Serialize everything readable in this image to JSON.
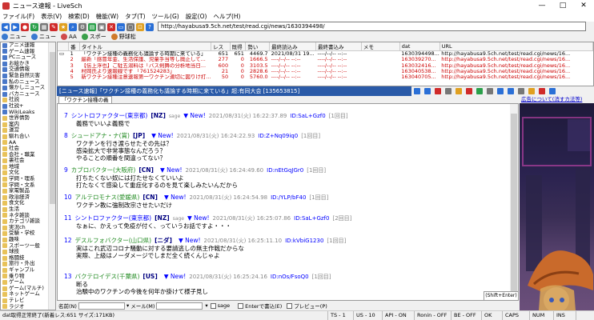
{
  "window": {
    "title": "ニュース速報 - LiveSch",
    "minimize": "—",
    "maximize": "□",
    "close": "✕"
  },
  "menu": [
    "ファイル(F)",
    "表示(V)",
    "検索(D)",
    "機能(W)",
    "タブ(T)",
    "ツール(G)",
    "設定(O)",
    "ヘルプ(H)"
  ],
  "url": "http://hayabusa9.5ch.net/test/read.cgi/news/1630394498/",
  "toolbar2": [
    {
      "label": "ニュー",
      "color": "#3a7ad0"
    },
    {
      "label": "ニュー",
      "color": "#3a7ad0"
    },
    {
      "label": "AA",
      "color": "#d04a4a"
    },
    {
      "label": "スポー",
      "color": "#3aa04a"
    },
    {
      "label": "野球松",
      "color": "#d07a2a"
    }
  ],
  "tree": [
    {
      "icon": "b",
      "label": "アニメ速報"
    },
    {
      "icon": "b",
      "label": "ゲーム速報"
    },
    {
      "icon": "b",
      "label": "PCニュース"
    },
    {
      "icon": "b",
      "label": "お絵かき"
    },
    {
      "icon": "b",
      "label": "交通情報"
    },
    {
      "icon": "b",
      "label": "緊急自然災害"
    },
    {
      "icon": "b",
      "label": "私のニュース"
    },
    {
      "icon": "b",
      "label": "懐かしニュース"
    },
    {
      "icon": "b",
      "label": "バカニュース"
    },
    {
      "icon": "f",
      "label": "社説"
    },
    {
      "icon": "b",
      "label": "社説+"
    },
    {
      "icon": "b",
      "label": "WikiLeaks"
    },
    {
      "icon": "f",
      "label": "世界情勢"
    },
    {
      "icon": "f",
      "label": "案内"
    },
    {
      "icon": "f",
      "label": "運営"
    },
    {
      "icon": "f",
      "label": "馴れ合い"
    },
    {
      "icon": "f",
      "label": "AA"
    },
    {
      "icon": "f",
      "label": "社会"
    },
    {
      "icon": "f",
      "label": "会社・職業"
    },
    {
      "icon": "f",
      "label": "裏社会"
    },
    {
      "icon": "f",
      "label": "地域"
    },
    {
      "icon": "f",
      "label": "文化"
    },
    {
      "icon": "f",
      "label": "学問・理系"
    },
    {
      "icon": "f",
      "label": "学問・文系"
    },
    {
      "icon": "f",
      "label": "家電製品"
    },
    {
      "icon": "f",
      "label": "政治経済"
    },
    {
      "icon": "f",
      "label": "食文化"
    },
    {
      "icon": "f",
      "label": "生活"
    },
    {
      "icon": "f",
      "label": "ネタ雑談"
    },
    {
      "icon": "f",
      "label": "カテゴリ雑談"
    },
    {
      "icon": "f",
      "label": "実況ch"
    },
    {
      "icon": "f",
      "label": "受験・学校"
    },
    {
      "icon": "f",
      "label": "趣味"
    },
    {
      "icon": "f",
      "label": "スポーツ一般"
    },
    {
      "icon": "f",
      "label": "球技"
    },
    {
      "icon": "f",
      "label": "格闘技"
    },
    {
      "icon": "f",
      "label": "旅行・外出"
    },
    {
      "icon": "f",
      "label": "ギャンブル"
    },
    {
      "icon": "f",
      "label": "乗り物"
    },
    {
      "icon": "f",
      "label": "ゲーム"
    },
    {
      "icon": "f",
      "label": "ゲーム(マルチ)"
    },
    {
      "icon": "f",
      "label": "ネットゲーム"
    },
    {
      "icon": "f",
      "label": "テレビ"
    },
    {
      "icon": "f",
      "label": "ラジオ"
    }
  ],
  "thread_list": {
    "headers": [
      "番",
      "タイトル",
      "レス",
      "既得",
      "勢い",
      "最終読込み",
      "最終書込み",
      "メモ",
      "dat",
      "URL"
    ],
    "rows": [
      {
        "no": "1",
        "title": "「ワクチン接種の義務化も議論する時期に来ている」",
        "res": "651",
        "got": "651",
        "ikioi": "4469.7",
        "last": "2021/08/31 19...",
        "write": "----/--/-- --:--",
        "memo": "",
        "dat": "1630394498...",
        "url": "http://hayabusa9.5ch.net/test/read.cgi/news/16...",
        "cls": "sel"
      },
      {
        "no": "2",
        "title": "最新「感冒年金、生活保護、児童手当等し廃止して...",
        "res": "277",
        "got": "0",
        "ikioi": "1666.5",
        "last": "----/--/-- --:--",
        "write": "----/--/-- --:--",
        "memo": "",
        "dat": "163039270...",
        "url": "http://hayabusa9.5ch.net/test/read.cgi/news/16...",
        "cls": "red"
      },
      {
        "no": "3",
        "title": "【伝上浮也】ご駐五湯料は「バス剣舞の分析地当日...",
        "res": "600",
        "got": "0",
        "ikioi": "3103.5",
        "last": "----/--/-- --:--",
        "write": "----/--/-- --:--",
        "memo": "",
        "dat": "163032416...",
        "url": "http://hayabusa9.5ch.net/test/read.cgi/news/16...",
        "cls": "red"
      },
      {
        "no": "4",
        "title": "村岡氏より速報線です 「761524283」",
        "res": "21",
        "got": "0",
        "ikioi": "2828.6",
        "last": "----/--/-- --:--",
        "write": "----/--/-- --:--",
        "memo": "",
        "dat": "163040538...",
        "url": "http://hayabusa9.5ch.net/test/read.cgi/news/16...",
        "cls": "red"
      },
      {
        "no": "5",
        "title": "新ワクチン接種注意速報第一ワクチン適切に図りけ打...",
        "res": "50",
        "got": "0",
        "ikioi": "5760.0",
        "last": "----/--/-- --:--",
        "write": "----/--/-- --:--",
        "memo": "",
        "dat": "163040705...",
        "url": "http://hayabusa9.5ch.net/test/read.cgi/news/16...",
        "cls": "red"
      }
    ]
  },
  "thread_title": "[ニュース速報]「ワクチン接種の義務化も議論する時期に来ている」超:有同大会 [135653815]",
  "tab_label": "「ワクチン接種の義",
  "ad_link": "広告について(消すカ法等)",
  "posts": [
    {
      "no": "7",
      "name": "シントロファクター(東京都)",
      "cc": "[NZ]",
      "sage": "sage",
      "new": "▼ New!",
      "date": "2021/08/31(火) 16:22:37.89",
      "id": "ID:SaL+Gzf0",
      "count": "[1回目]",
      "lines": [
        "義務でいいよ義務で"
      ],
      "namecol": "nmb"
    },
    {
      "no": "8",
      "name": "シュードアナ・ナ(賞)",
      "cc": "[JP]",
      "sage": "",
      "new": "▼ New!",
      "date": "2021/08/31(火) 16:24:22.93",
      "id": "ID:Z+Nq09iq0",
      "count": "[1回目]",
      "lines": [
        "ワクチンを行き渡らせたその先は？",
        "感染拡大で非常事態なんだろう？",
        "やることの順番を間違ってない？"
      ],
      "namecol": "nm"
    },
    {
      "no": "9",
      "name": "カブロバクター(大阪府)",
      "cc": "[CN]",
      "sage": "",
      "new": "▼ New!",
      "date": "2021/08/31(火) 16:24:49.60",
      "id": "ID:nEtGqJGr0",
      "count": "[1回目]",
      "lines": [
        "打ちたくない奴には打たせなくていいよ",
        "打たなくて感染して重症化するのを見て楽しみたいんだから"
      ],
      "namecol": "nm"
    },
    {
      "no": "10",
      "name": "アルテロモナス(愛媛県)",
      "cc": "[CN]",
      "sage": "",
      "new": "▼ New!",
      "date": "2021/08/31(火) 16:24:54.98",
      "id": "ID:/YLP/bF40",
      "count": "[1回目]",
      "lines": [
        "ワクチン教に強制改宗させたいだけ"
      ],
      "namecol": "nm"
    },
    {
      "no": "11",
      "name": "シントロファクター(東京都)",
      "cc": "[NZ]",
      "sage": "sage",
      "new": "▼ New!",
      "date": "2021/08/31(火) 16:25:07.86",
      "id": "ID:SaL+Gzf0",
      "count": "[2回目]",
      "lines": [
        "なぁに、かえって免疫が付く、っていうお話ですよ・・・"
      ],
      "namecol": "nmb"
    },
    {
      "no": "12",
      "name": "デスルフォバクター(山口県)",
      "cc": "[ニダ]",
      "sage": "",
      "new": "▼ New!",
      "date": "2021/08/31(火) 16:25:11.10",
      "id": "ID:kVbiG1230",
      "count": "[1回目]",
      "lines": [
        "実はこれ武辺コロナ騒動に対する要請逃しの無主作戦だからな",
        "実際、上級はノーダメージでしまだ全く続くんじゃよ"
      ],
      "namecol": "nm"
    },
    {
      "no": "13",
      "name": "バクテロイデス(千葉県)",
      "cc": "[US]",
      "sage": "",
      "new": "▼ New!",
      "date": "2021/08/31(火) 16:25:24.16",
      "id": "ID:nOs/FsoQ0",
      "count": "[1回目]",
      "lines": [
        "断る",
        "治験中のワクチンの今後を何年か掛けて様子見し"
      ],
      "namecol": "nm"
    }
  ],
  "form": {
    "name_label": "名前(N)",
    "mail_label": "メール(M)",
    "sage": "sage",
    "enter_label": "Enterで書込(E)",
    "preview_label": "プレビュー(P)",
    "post_button": "(Shift+Enter)"
  },
  "status": [
    "dat取得正常終了(新着レス:651 サイズ:171KB)",
    "TS - 1",
    "US - 10",
    "API - ON",
    "Ronin - OFF",
    "BE - OFF",
    "OK",
    "CAPS",
    "NUM",
    "INS"
  ]
}
